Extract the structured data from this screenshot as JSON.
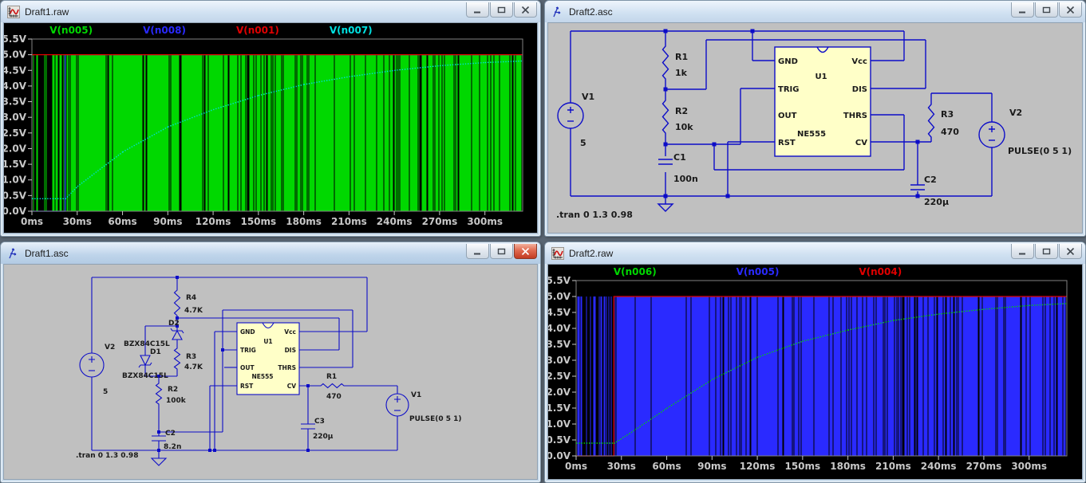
{
  "windows": [
    {
      "title": "Draft1.raw",
      "kind": "waveform",
      "active": false,
      "controls": {
        "minimize": "minimize",
        "maximize": "maximize",
        "close": "close"
      }
    },
    {
      "title": "Draft2.asc",
      "kind": "schematic",
      "active": false,
      "controls": {
        "minimize": "minimize",
        "maximize": "maximize",
        "close": "close"
      }
    },
    {
      "title": "Draft1.asc",
      "kind": "schematic",
      "active": true,
      "controls": {
        "minimize": "minimize",
        "maximize": "maximize",
        "close": "close"
      }
    },
    {
      "title": "Draft2.raw",
      "kind": "waveform",
      "active": false,
      "controls": {
        "minimize": "minimize",
        "maximize": "maximize",
        "close": "close"
      }
    }
  ],
  "chart_data": [
    {
      "window": "Draft1.raw",
      "type": "line",
      "background": "#000000",
      "legend_position": "top",
      "grid": false,
      "x_axis": {
        "unit": "ms",
        "range_ms": [
          0,
          325
        ],
        "tick_labels": [
          "0ms",
          "30ms",
          "60ms",
          "90ms",
          "120ms",
          "150ms",
          "180ms",
          "210ms",
          "240ms",
          "270ms",
          "300ms"
        ],
        "tick_values_ms": [
          0,
          30,
          60,
          90,
          120,
          150,
          180,
          210,
          240,
          270,
          300
        ]
      },
      "y_axis": {
        "unit": "V",
        "range_v": [
          0,
          5.5
        ],
        "tick_labels": [
          "5.5V",
          "5.0V",
          "4.5V",
          "4.0V",
          "3.5V",
          "3.0V",
          "2.5V",
          "2.0V",
          "1.5V",
          "1.0V",
          "0.5V",
          "0.0V"
        ],
        "tick_values_v": [
          5.5,
          5.0,
          4.5,
          4.0,
          3.5,
          3.0,
          2.5,
          2.0,
          1.5,
          1.0,
          0.5,
          0.0
        ]
      },
      "series": [
        {
          "name": "V(n005)",
          "color": "#00d800",
          "style": "square-oscillation",
          "levels_v": [
            0,
            5
          ],
          "sparse_until_ms": 22,
          "solid_bands_ms": [
            [
              35,
              49
            ],
            [
              56,
              73
            ],
            [
              77,
              88
            ]
          ]
        },
        {
          "name": "V(n008)",
          "color": "#2a2aff",
          "style": "step",
          "points_ms_v": [
            [
              0,
              0
            ],
            [
              22,
              0
            ],
            [
              22,
              5
            ],
            [
              325,
              5
            ]
          ]
        },
        {
          "name": "V(n001)",
          "color": "#e00000",
          "style": "line",
          "points_ms_v": [
            [
              0,
              5
            ],
            [
              325,
              5
            ]
          ]
        },
        {
          "name": "V(n007)",
          "color": "#00e0e0",
          "style": "dotted-curve",
          "points_ms_v": [
            [
              0,
              0.4
            ],
            [
              22,
              0.4
            ],
            [
              30,
              0.8
            ],
            [
              60,
              1.9
            ],
            [
              90,
              2.7
            ],
            [
              120,
              3.25
            ],
            [
              150,
              3.7
            ],
            [
              180,
              4.05
            ],
            [
              210,
              4.3
            ],
            [
              240,
              4.5
            ],
            [
              270,
              4.65
            ],
            [
              300,
              4.75
            ],
            [
              325,
              4.8
            ]
          ]
        }
      ]
    },
    {
      "window": "Draft2.raw",
      "type": "line",
      "background": "#000000",
      "legend_position": "top",
      "grid": false,
      "x_axis": {
        "unit": "ms",
        "range_ms": [
          0,
          325
        ],
        "tick_labels": [
          "0ms",
          "30ms",
          "60ms",
          "90ms",
          "120ms",
          "150ms",
          "180ms",
          "210ms",
          "240ms",
          "270ms",
          "300ms"
        ],
        "tick_values_ms": [
          0,
          30,
          60,
          90,
          120,
          150,
          180,
          210,
          240,
          270,
          300
        ]
      },
      "y_axis": {
        "unit": "V",
        "range_v": [
          0,
          5.5
        ],
        "tick_labels": [
          "5.5V",
          "5.0V",
          "4.5V",
          "4.0V",
          "3.5V",
          "3.0V",
          "2.5V",
          "2.0V",
          "1.5V",
          "1.0V",
          "0.5V",
          "0.0V"
        ],
        "tick_values_v": [
          5.5,
          5.0,
          4.5,
          4.0,
          3.5,
          3.0,
          2.5,
          2.0,
          1.5,
          1.0,
          0.5,
          0.0
        ]
      },
      "series": [
        {
          "name": "V(n006)",
          "color": "#00d800",
          "style": "dotted-curve",
          "points_ms_v": [
            [
              0,
              0.4
            ],
            [
              25,
              0.4
            ],
            [
              35,
              0.7
            ],
            [
              60,
              1.5
            ],
            [
              90,
              2.4
            ],
            [
              120,
              3.1
            ],
            [
              150,
              3.6
            ],
            [
              180,
              3.95
            ],
            [
              210,
              4.25
            ],
            [
              240,
              4.45
            ],
            [
              270,
              4.6
            ],
            [
              300,
              4.72
            ],
            [
              325,
              4.78
            ]
          ]
        },
        {
          "name": "V(n005)",
          "color": "#2a2aff",
          "style": "square-oscillation",
          "levels_v": [
            0,
            5
          ],
          "sparse_until_ms": 25,
          "solid_bands_ms": [
            [
              27,
              33
            ],
            [
              50,
              70
            ]
          ]
        },
        {
          "name": "V(n004)",
          "color": "#e00000",
          "style": "step",
          "points_ms_v": [
            [
              0,
              0
            ],
            [
              25,
              0
            ],
            [
              25,
              5
            ],
            [
              325,
              5
            ]
          ]
        }
      ]
    }
  ],
  "schematics": [
    {
      "window": "Draft2.asc",
      "directive": ".tran 0 1.3 0.98",
      "components": [
        {
          "ref": "V1",
          "value": "5",
          "type": "voltage-source"
        },
        {
          "ref": "R1",
          "value": "1k",
          "type": "resistor"
        },
        {
          "ref": "R2",
          "value": "10k",
          "type": "resistor"
        },
        {
          "ref": "C1",
          "value": "100n",
          "type": "capacitor"
        },
        {
          "ref": "U1",
          "value": "NE555",
          "type": "ic",
          "pins_left": [
            "GND",
            "TRIG",
            "OUT",
            "RST"
          ],
          "pins_right": [
            "Vcc",
            "DIS",
            "THRS",
            "CV"
          ]
        },
        {
          "ref": "R3",
          "value": "470",
          "type": "resistor"
        },
        {
          "ref": "C2",
          "value": "220µ",
          "type": "capacitor"
        },
        {
          "ref": "V2",
          "value": "PULSE(0 5 1)",
          "type": "voltage-source"
        }
      ]
    },
    {
      "window": "Draft1.asc",
      "directive": ".tran 0 1.3 0.98",
      "components": [
        {
          "ref": "V2",
          "value": "5",
          "type": "voltage-source"
        },
        {
          "ref": "R4",
          "value": "4.7K",
          "type": "resistor"
        },
        {
          "ref": "D2",
          "value": "BZX84C15L",
          "type": "zener-diode"
        },
        {
          "ref": "D1",
          "value": "BZX84C15L",
          "type": "zener-diode"
        },
        {
          "ref": "R3",
          "value": "4.7K",
          "type": "resistor"
        },
        {
          "ref": "R2",
          "value": "100k",
          "type": "resistor"
        },
        {
          "ref": "C2",
          "value": "8.2n",
          "type": "capacitor"
        },
        {
          "ref": "U1",
          "value": "NE555",
          "type": "ic",
          "pins_left": [
            "GND",
            "TRIG",
            "OUT",
            "RST"
          ],
          "pins_right": [
            "Vcc",
            "DIS",
            "THRS",
            "CV"
          ]
        },
        {
          "ref": "R1",
          "value": "470",
          "type": "resistor"
        },
        {
          "ref": "C3",
          "value": "220µ",
          "type": "capacitor"
        },
        {
          "ref": "V1",
          "value": "PULSE(0 5 1)",
          "type": "voltage-source"
        }
      ]
    }
  ],
  "colors": {
    "schematic_bg": "#c0c0c0",
    "wire": "#0c0cc8",
    "ic_fill": "#ffffc8",
    "component_text": "#1a1a1a",
    "plot_axis_text": "#c8c8c8",
    "plot_border": "#828282",
    "trace_green": "#00d800",
    "trace_blue": "#2a2aff",
    "trace_red": "#e00000",
    "trace_cyan": "#00e0e0"
  }
}
